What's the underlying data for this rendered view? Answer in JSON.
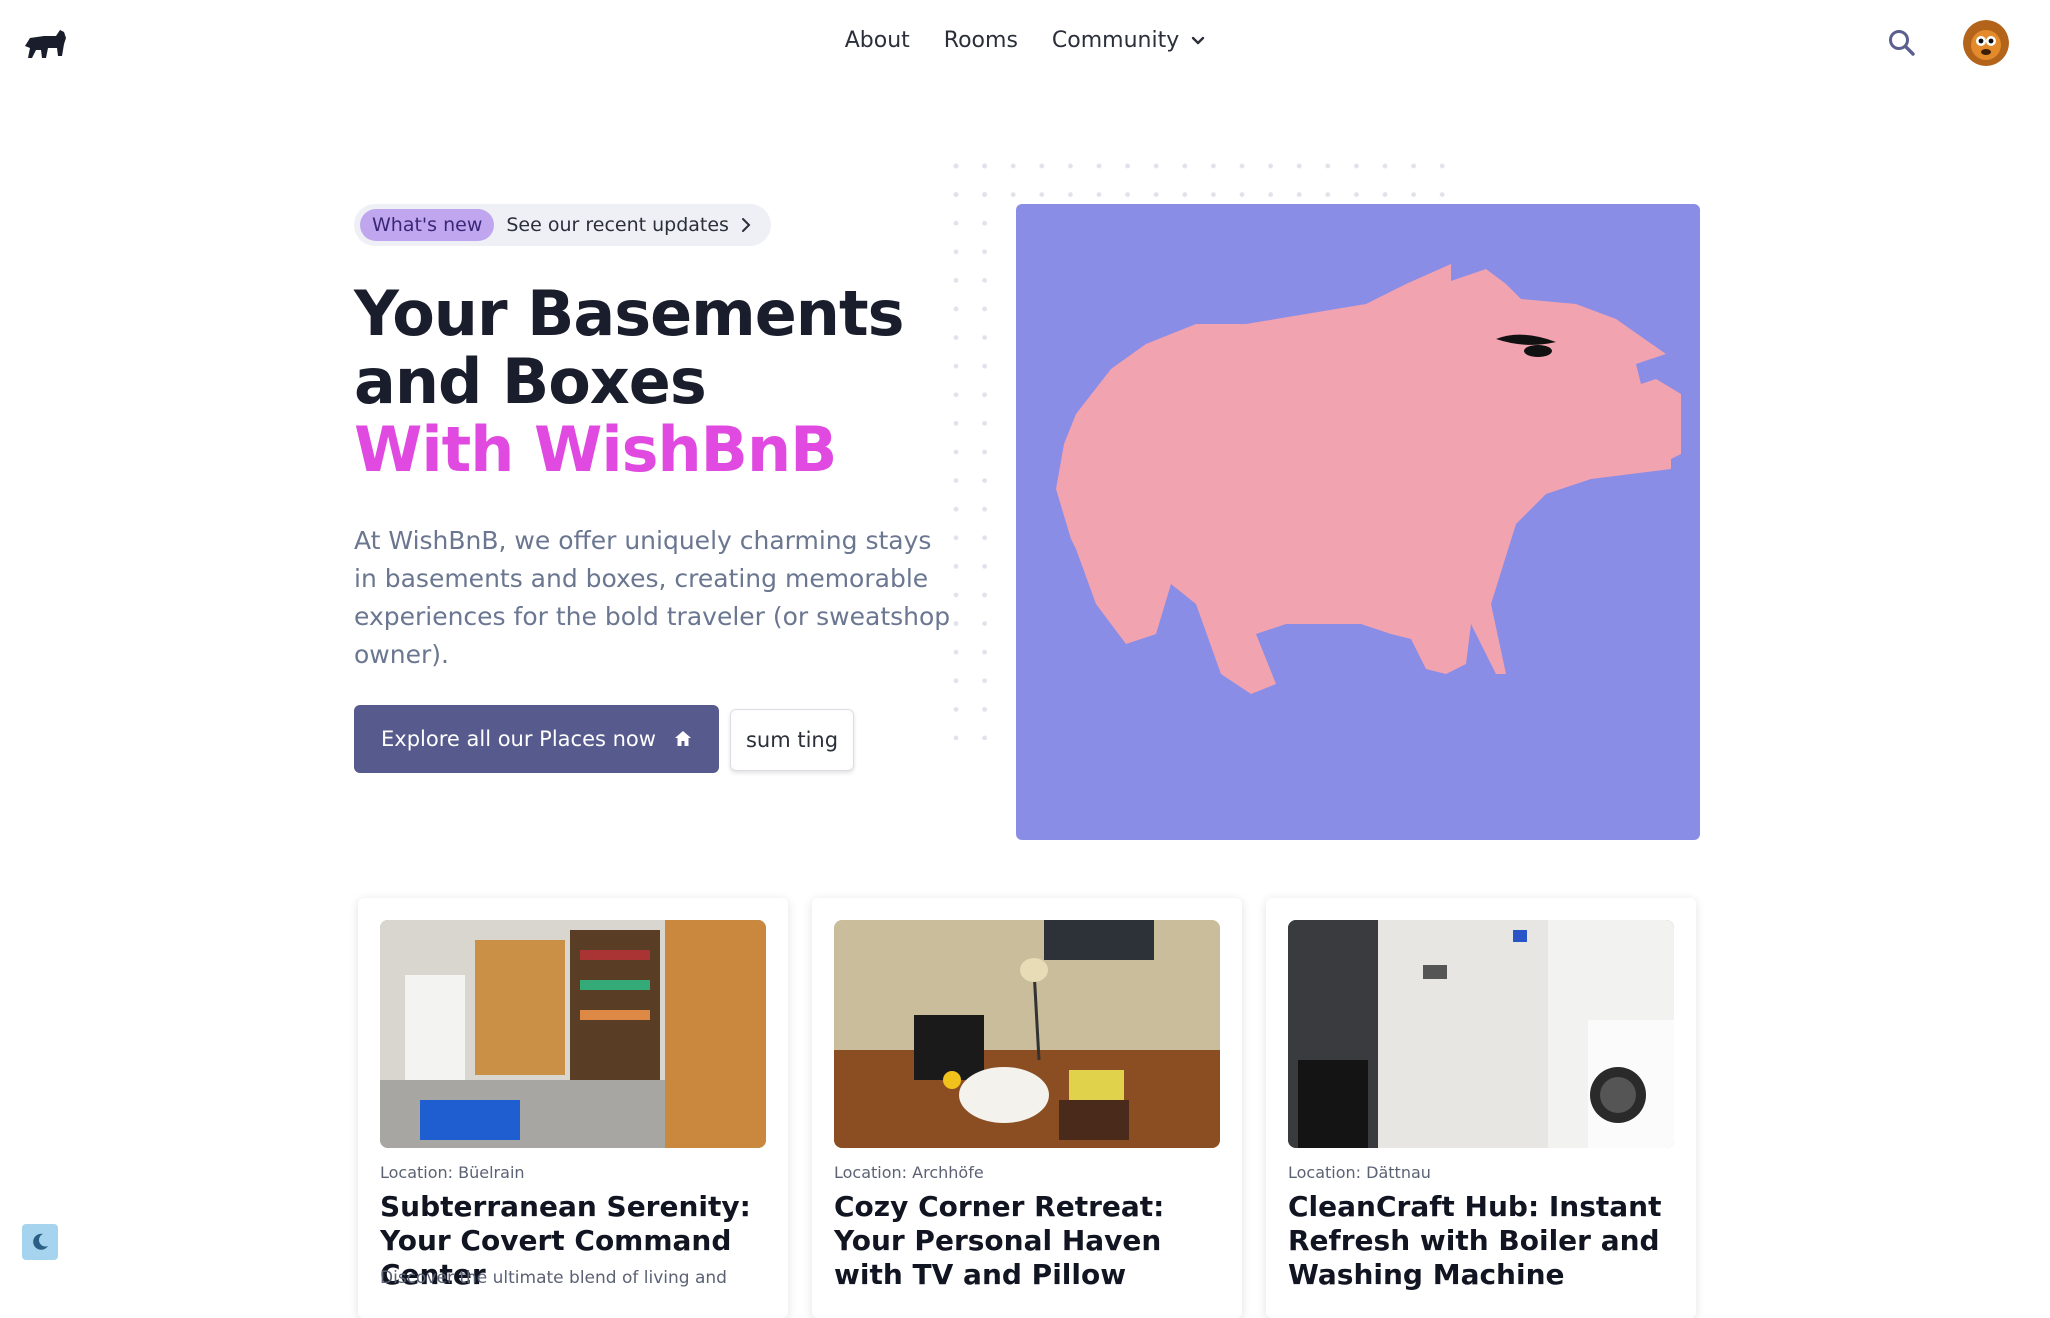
{
  "nav": {
    "links": [
      {
        "label": "About"
      },
      {
        "label": "Rooms"
      },
      {
        "label": "Community"
      }
    ]
  },
  "hero": {
    "badge": "What's new",
    "badge_link": "See our recent updates",
    "title_line1": "Your Basements",
    "title_line2": "and Boxes",
    "title_accent": "With WishBnB",
    "description": "At WishBnB, we offer uniquely charming stays in basements and boxes, creating memorable experiences for the bold traveler (or sweatshop owner).",
    "primary_button": "Explore all our Places now",
    "secondary_button": "sum ting"
  },
  "cards": [
    {
      "location": "Location: Büelrain",
      "title": "Subterranean Serenity: Your Covert Command Center",
      "description": "Discover the ultimate blend of living and"
    },
    {
      "location": "Location: Archhöfe",
      "title": "Cozy Corner Retreat: Your Personal Haven with TV and Pillow",
      "description": ""
    },
    {
      "location": "Location: Dättnau",
      "title": "CleanCraft Hub: Instant Refresh with Boiler and Washing Machine",
      "description": ""
    }
  ],
  "colors": {
    "primary_button": "#575a8c",
    "accent_text": "#e04ae0",
    "hero_bg": "#8a8de6",
    "mascot": "#f2a3b0",
    "badge_pill": "#c0a6ee"
  },
  "icons": [
    "logo-icon",
    "chevron-down-icon",
    "search-icon",
    "avatar",
    "chevron-right-icon",
    "home-icon",
    "moon-icon"
  ]
}
